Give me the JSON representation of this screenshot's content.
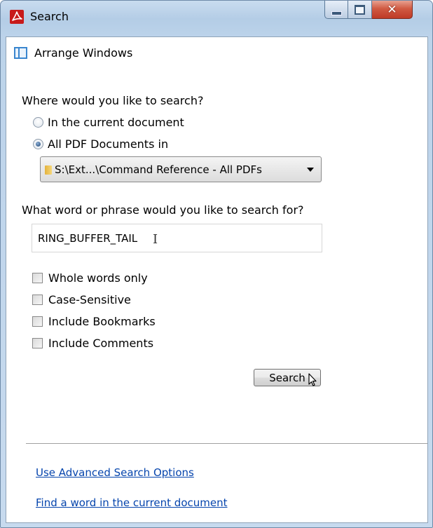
{
  "window": {
    "title": "Search"
  },
  "arrange": {
    "label": "Arrange Windows"
  },
  "where": {
    "question": "Where would you like to search?",
    "options": [
      {
        "label": "In the current document",
        "selected": false
      },
      {
        "label": "All PDF Documents in",
        "selected": true
      }
    ],
    "location_value": "S:\\Ext...\\Command Reference - All PDFs"
  },
  "phrase": {
    "question": "What word or phrase would you like to search for?",
    "value": "RING_BUFFER_TAIL"
  },
  "options": [
    {
      "label": "Whole words only",
      "checked": false
    },
    {
      "label": "Case-Sensitive",
      "checked": false
    },
    {
      "label": "Include Bookmarks",
      "checked": false
    },
    {
      "label": "Include Comments",
      "checked": false
    }
  ],
  "search_button": {
    "label": "Search"
  },
  "links": {
    "advanced": "Use Advanced Search Options",
    "find_word": "Find a word in the current document"
  },
  "colors": {
    "link": "#0645ad",
    "titlebar": "#b4cde6",
    "close_button": "#c9452f",
    "app_icon": "#c81a1a"
  }
}
